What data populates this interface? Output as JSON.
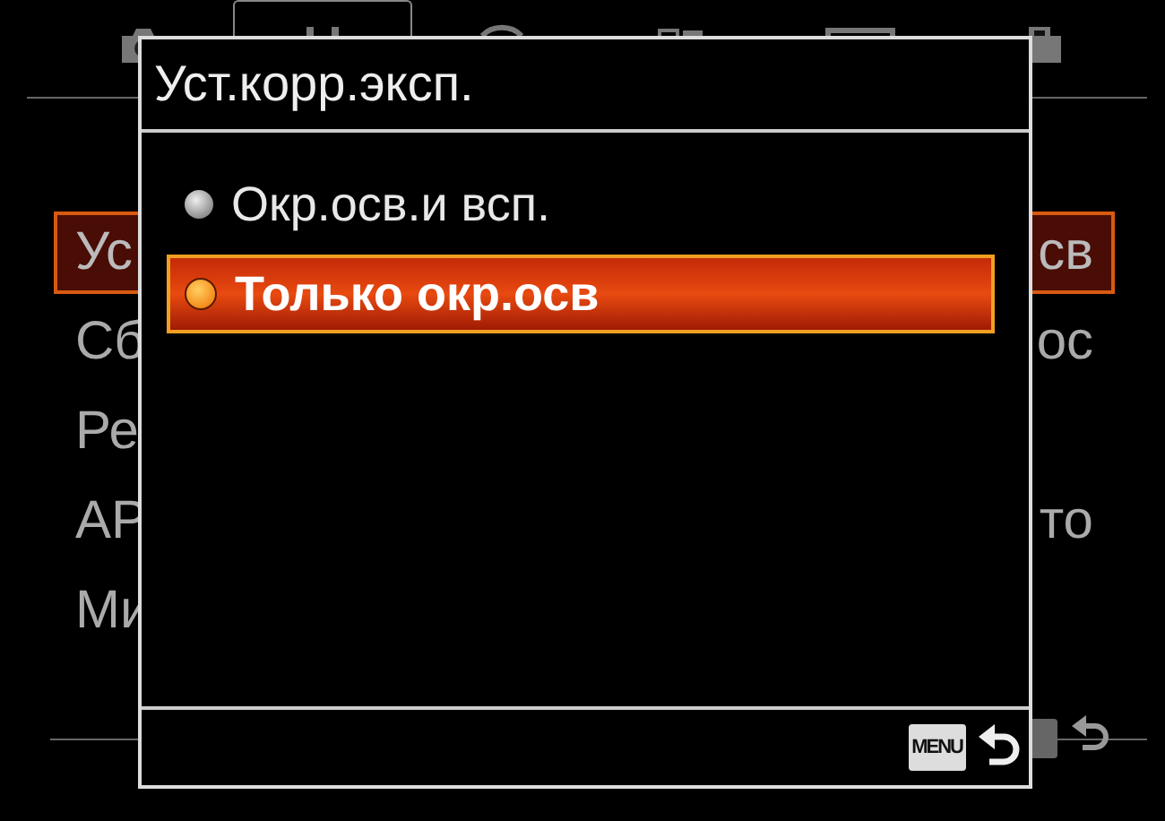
{
  "tabs": [
    {
      "selected": false
    },
    {
      "selected": true
    },
    {
      "selected": false
    },
    {
      "selected": false
    },
    {
      "selected": false
    },
    {
      "selected": false
    }
  ],
  "menu_rows": [
    {
      "label": "Ус",
      "value": "св",
      "selected": true
    },
    {
      "label": "Сб",
      "value": "ос",
      "selected": false
    },
    {
      "label": "Ре",
      "selected": false
    },
    {
      "label": "АР",
      "value": "то",
      "selected": false
    },
    {
      "label": "Ми",
      "selected": false
    }
  ],
  "dialog": {
    "title": "Уст.корр.эксп.",
    "options": [
      {
        "label": "Окр.осв.и всп.",
        "selected": false
      },
      {
        "label": "Только окр.осв",
        "selected": true
      }
    ],
    "footer": {
      "key": "MENU"
    }
  }
}
